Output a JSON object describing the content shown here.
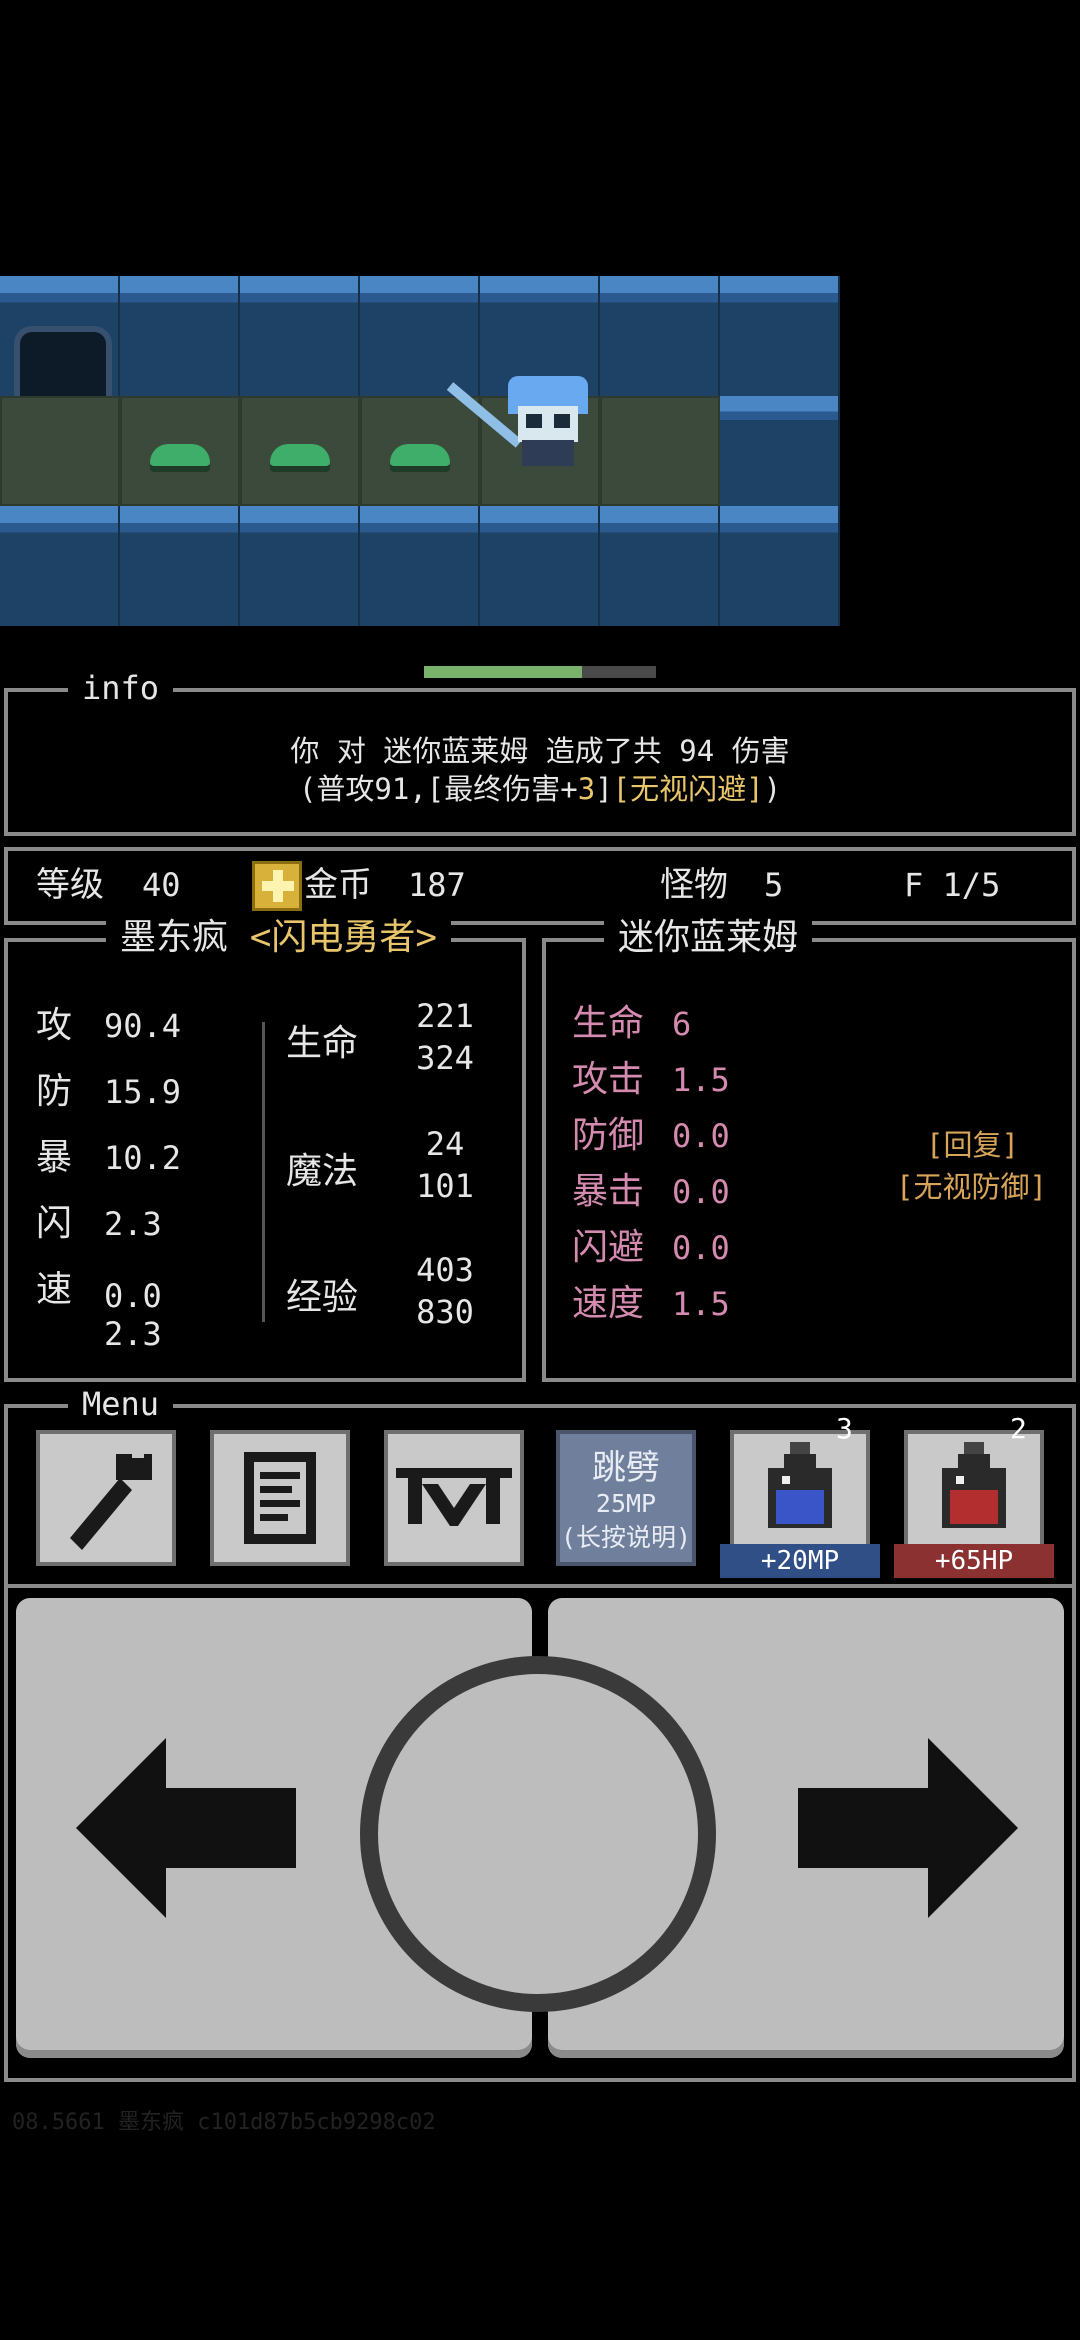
{
  "info": {
    "title": "info",
    "line1": "你 对 迷你蓝莱姆 造成了共 94 伤害",
    "line2_prefix": "(普攻91,[最终伤害+",
    "line2_value": "3",
    "line2_mid": "]",
    "line2_tag": "[无视闪避]",
    "line2_suffix": ")"
  },
  "status": {
    "level_label": "等级",
    "level_value": "40",
    "gold_label": "金币",
    "gold_value": "187",
    "monster_label": "怪物",
    "monster_value": "5",
    "floor_text": "F 1/5"
  },
  "hero": {
    "name": "墨东疯",
    "title": "<闪电勇者>",
    "stats": [
      {
        "label": "攻",
        "value": "90.4"
      },
      {
        "label": "防",
        "value": "15.9"
      },
      {
        "label": "暴",
        "value": "10.2"
      },
      {
        "label": "闪",
        "value": "2.3"
      },
      {
        "label": "速",
        "value": "0.0"
      }
    ],
    "speed_extra": "2.3",
    "hp_label": "生命",
    "hp_current": "221",
    "hp_max": "324",
    "mp_label": "魔法",
    "mp_current": "24",
    "mp_max": "101",
    "exp_label": "经验",
    "exp_current": "403",
    "exp_max": "830"
  },
  "enemy": {
    "name": "迷你蓝莱姆",
    "stats": [
      {
        "label": "生命",
        "value": "6"
      },
      {
        "label": "攻击",
        "value": "1.5"
      },
      {
        "label": "防御",
        "value": "0.0"
      },
      {
        "label": "暴击",
        "value": "0.0"
      },
      {
        "label": "闪避",
        "value": "0.0"
      },
      {
        "label": "速度",
        "value": "1.5"
      }
    ],
    "traits": [
      "[回复]",
      "[无视防御]"
    ]
  },
  "menu": {
    "title": "Menu",
    "skill_name": "跳劈",
    "skill_cost": "25MP",
    "skill_hint": "(长按说明)",
    "mp_potion_count": "3",
    "mp_potion_label": "+20MP",
    "hp_potion_count": "2",
    "hp_potion_label": "+65HP"
  },
  "progress": {
    "fraction": 0.68
  },
  "footer": "08.5661 墨东疯 c101d87b5cb9298c02",
  "colors": {
    "accent": "#e8c56a",
    "enemy_label": "#d58ab0",
    "trait": "#d7a45a",
    "mp_label_bg": "#2f4f86",
    "hp_label_bg": "#8b3131"
  }
}
